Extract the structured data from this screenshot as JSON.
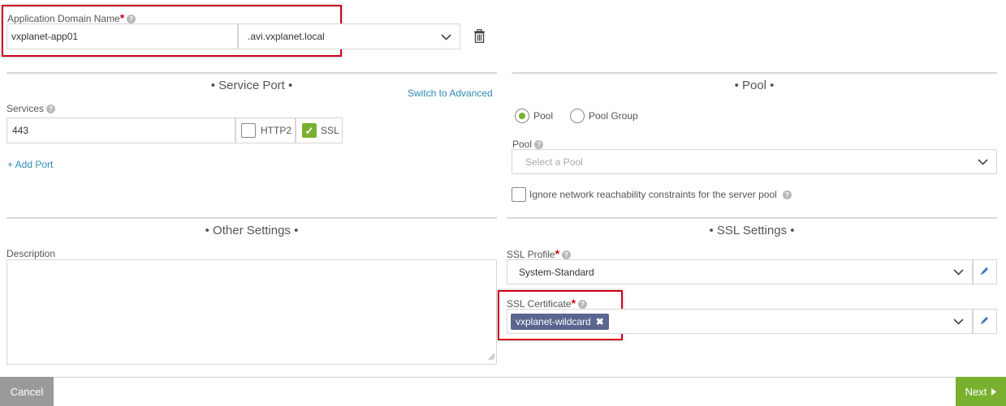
{
  "app_domain": {
    "label": "Application Domain Name",
    "required_mark": "*",
    "value": "vxplanet-app01",
    "suffix": ".avi.vxplanet.local"
  },
  "service_port": {
    "title": "• Service Port •",
    "switch_advanced": "Switch to Advanced",
    "services_label": "Services",
    "port_value": "443",
    "http2_label": "HTTP2",
    "http2_checked": false,
    "ssl_label": "SSL",
    "ssl_checked": true,
    "add_port": "+ Add Port"
  },
  "pool": {
    "title": "• Pool •",
    "radio_pool": "Pool",
    "radio_pool_group": "Pool Group",
    "selected": "Pool",
    "pool_label": "Pool",
    "pool_placeholder": "Select a Pool",
    "ignore_label": "Ignore network reachability constraints for the server pool",
    "ignore_checked": false
  },
  "other_settings": {
    "title": "• Other Settings •",
    "description_label": "Description",
    "description_value": ""
  },
  "ssl_settings": {
    "title": "• SSL Settings •",
    "profile_label": "SSL Profile",
    "profile_required": "*",
    "profile_value": "System-Standard",
    "cert_label": "SSL Certificate",
    "cert_required": "*",
    "cert_tag": "vxplanet-wildcard"
  },
  "footer": {
    "cancel": "Cancel",
    "next": "Next"
  },
  "colors": {
    "accent_green": "#7ab030",
    "tag_bg": "#5b6590",
    "highlight_red": "#d0021b",
    "link_blue": "#2d8bb5"
  },
  "icons": {
    "delete": "trash-icon",
    "help": "help-circle-icon",
    "dropdown": "chevron-down-icon",
    "edit": "pencil-icon",
    "remove_tag": "close-icon",
    "next": "caret-right-icon"
  }
}
